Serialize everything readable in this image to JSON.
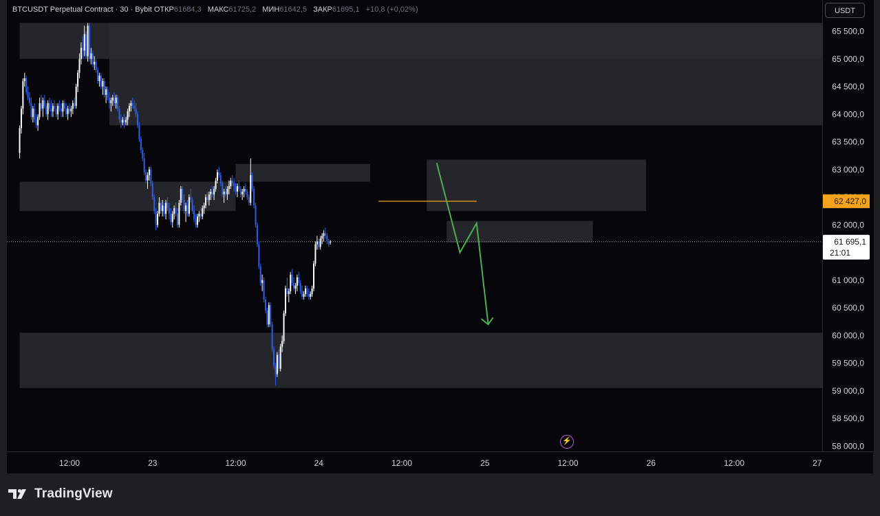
{
  "legend": {
    "symbol": "BTCUSDT Perpetual Contract · 30 · Bybit",
    "open_label": "ОТКР",
    "open_value": "61684,3",
    "high_label": "МАКС",
    "high_value": "61725,2",
    "low_label": "МИН",
    "low_value": "61642,5",
    "close_label": "ЗАКР",
    "close_value": "61695,1",
    "change": "+10,8 (+0,02%)"
  },
  "currency_button": "USDT",
  "brand": "TradingView",
  "colors": {
    "background": "#07070b",
    "frame": "#1e1f22",
    "bull": "#ffffff",
    "bear": "#2f5ee8",
    "zone": "#2a2b31",
    "orange": "#f5a31a",
    "green_arrow": "#4caf50"
  },
  "chart_data": {
    "type": "candlestick",
    "title": "",
    "xlabel": "",
    "ylabel": "",
    "ylim": [
      57800,
      66250
    ],
    "price_ticks": [
      "65 500,0",
      "65 000,0",
      "64 500,0",
      "64 000,0",
      "63 500,0",
      "63 000,0",
      "62 500,0",
      "62 000,0",
      "61 500,0",
      "61 000,0",
      "60 500,0",
      "60 000,0",
      "59 500,0",
      "59 000,0",
      "58 500,0",
      "58 000,0"
    ],
    "time_ticks": [
      {
        "label": "12:00",
        "t": 2.5
      },
      {
        "label": "23",
        "t": 7.5
      },
      {
        "label": "12:00",
        "t": 12.5
      },
      {
        "label": "24",
        "t": 17.5
      },
      {
        "label": "12:00",
        "t": 22.5
      },
      {
        "label": "25",
        "t": 27.5
      },
      {
        "label": "12:00",
        "t": 32.5
      },
      {
        "label": "26",
        "t": 37.5
      },
      {
        "label": "12:00",
        "t": 42.5
      },
      {
        "label": "27",
        "t": 47.5
      }
    ],
    "current_price": {
      "value": 61695.1,
      "label": "61 695,1",
      "countdown": "21:01"
    },
    "marked_price": {
      "value": 62427,
      "label": "62 427,0"
    },
    "zones": [
      {
        "t0": -0.5,
        "t1": 48.5,
        "low": 65000,
        "high": 65650
      },
      {
        "t0": 4.9,
        "t1": 48.5,
        "low": 63800,
        "high": 65650
      },
      {
        "t0": -0.5,
        "t1": 12.5,
        "low": 62250,
        "high": 62780
      },
      {
        "t0": 12.5,
        "t1": 20.6,
        "low": 62780,
        "high": 63100
      },
      {
        "t0": 24.0,
        "t1": 37.2,
        "low": 62250,
        "high": 63180
      },
      {
        "t0": 25.2,
        "t1": 34.0,
        "low": 61680,
        "high": 62070
      },
      {
        "t0": -0.5,
        "t1": 48.5,
        "low": 59050,
        "high": 60050
      }
    ],
    "orange_line": {
      "t0": 21.1,
      "t1": 27.0,
      "value": 62427
    },
    "green_arrow": [
      {
        "t": 24.6,
        "v": 63120
      },
      {
        "t": 26.0,
        "v": 61500
      },
      {
        "t": 27.0,
        "v": 62030
      },
      {
        "t": 27.7,
        "v": 60200
      }
    ],
    "candles": [
      [
        -0.5,
        63300,
        63800,
        63200,
        63750
      ],
      [
        -0.4,
        63750,
        64150,
        63650,
        64100
      ],
      [
        -0.3,
        64100,
        64650,
        64000,
        64600
      ],
      [
        -0.2,
        64600,
        64750,
        64500,
        64650
      ],
      [
        -0.1,
        64650,
        64700,
        64350,
        64400
      ],
      [
        0.0,
        64400,
        64500,
        64250,
        64300
      ],
      [
        0.1,
        64300,
        64400,
        64150,
        64200
      ],
      [
        0.2,
        64200,
        64300,
        63900,
        63950
      ],
      [
        0.3,
        63950,
        64150,
        63850,
        64100
      ],
      [
        0.4,
        64100,
        64200,
        63850,
        63900
      ],
      [
        0.5,
        63900,
        64000,
        63750,
        63800
      ],
      [
        0.6,
        63800,
        64000,
        63700,
        63950
      ],
      [
        0.7,
        63950,
        64300,
        63900,
        64200
      ],
      [
        0.8,
        64200,
        64350,
        64050,
        64100
      ],
      [
        0.9,
        64100,
        64300,
        63950,
        64250
      ],
      [
        1.0,
        64250,
        64350,
        64100,
        64150
      ],
      [
        1.1,
        64150,
        64200,
        63950,
        64000
      ],
      [
        1.2,
        64000,
        64250,
        63900,
        64200
      ],
      [
        1.3,
        64200,
        64300,
        64050,
        64100
      ],
      [
        1.4,
        64100,
        64250,
        63950,
        64050
      ],
      [
        1.5,
        64050,
        64200,
        63950,
        64150
      ],
      [
        1.6,
        64150,
        64250,
        64050,
        64100
      ],
      [
        1.7,
        64100,
        64200,
        63950,
        64000
      ],
      [
        1.8,
        64000,
        64200,
        63900,
        64150
      ],
      [
        1.9,
        64150,
        64250,
        64050,
        64100
      ],
      [
        2.0,
        64100,
        64200,
        63950,
        64050
      ],
      [
        2.1,
        64050,
        64250,
        63950,
        64200
      ],
      [
        2.2,
        64200,
        64250,
        64050,
        64100
      ],
      [
        2.3,
        64100,
        64200,
        63950,
        64000
      ],
      [
        2.4,
        64000,
        64150,
        63900,
        64100
      ],
      [
        2.5,
        64100,
        64200,
        64000,
        64050
      ],
      [
        2.6,
        64050,
        64150,
        63950,
        64100
      ],
      [
        2.7,
        64100,
        64250,
        64000,
        64200
      ],
      [
        2.8,
        64200,
        64300,
        64100,
        64150
      ],
      [
        2.9,
        64150,
        64550,
        64100,
        64500
      ],
      [
        3.0,
        64500,
        64800,
        64400,
        64750
      ],
      [
        3.1,
        64750,
        65100,
        64650,
        65000
      ],
      [
        3.2,
        65000,
        65300,
        64900,
        65200
      ],
      [
        3.3,
        65200,
        65400,
        65000,
        65150
      ],
      [
        3.4,
        65150,
        65600,
        65050,
        65450
      ],
      [
        3.5,
        65450,
        65500,
        65000,
        65050
      ],
      [
        3.6,
        65050,
        65650,
        64950,
        65600
      ],
      [
        3.7,
        65600,
        65650,
        64950,
        65000
      ],
      [
        3.8,
        65000,
        65200,
        64900,
        65100
      ],
      [
        3.9,
        65100,
        65150,
        64850,
        64900
      ],
      [
        4.0,
        64900,
        65050,
        64800,
        64950
      ],
      [
        4.1,
        64950,
        65000,
        64750,
        64800
      ],
      [
        4.2,
        64800,
        64850,
        64550,
        64600
      ],
      [
        4.3,
        64600,
        64750,
        64500,
        64700
      ],
      [
        4.4,
        64700,
        64750,
        64450,
        64500
      ],
      [
        4.5,
        64500,
        64650,
        64350,
        64600
      ],
      [
        4.6,
        64600,
        64650,
        64300,
        64350
      ],
      [
        4.7,
        64350,
        64500,
        64200,
        64450
      ],
      [
        4.8,
        64450,
        64500,
        64250,
        64300
      ],
      [
        4.9,
        64300,
        64400,
        64100,
        64200
      ],
      [
        5.0,
        64200,
        64300,
        64050,
        64250
      ],
      [
        5.1,
        64250,
        64350,
        64150,
        64300
      ],
      [
        5.2,
        64300,
        64400,
        64150,
        64200
      ],
      [
        5.3,
        64200,
        64350,
        64100,
        64300
      ],
      [
        5.4,
        64300,
        64350,
        64050,
        64100
      ],
      [
        5.5,
        64100,
        64150,
        63850,
        63900
      ],
      [
        5.6,
        63900,
        64000,
        63750,
        63850
      ],
      [
        5.7,
        63850,
        63950,
        63800,
        63900
      ],
      [
        5.8,
        63900,
        64000,
        63750,
        63850
      ],
      [
        5.9,
        63850,
        63950,
        63800,
        63900
      ],
      [
        6.0,
        63900,
        64100,
        63800,
        64050
      ],
      [
        6.1,
        64050,
        64200,
        63950,
        64150
      ],
      [
        6.2,
        64150,
        64250,
        64050,
        64200
      ],
      [
        6.3,
        64200,
        64300,
        64100,
        64150
      ],
      [
        6.4,
        64150,
        64250,
        64050,
        64100
      ],
      [
        6.5,
        64100,
        64200,
        63950,
        64000
      ],
      [
        6.6,
        64000,
        64050,
        63750,
        63800
      ],
      [
        6.7,
        63800,
        63850,
        63500,
        63550
      ],
      [
        6.8,
        63550,
        63600,
        63300,
        63350
      ],
      [
        6.9,
        63350,
        63400,
        63150,
        63200
      ],
      [
        7.0,
        63200,
        63300,
        62900,
        62950
      ],
      [
        7.1,
        62950,
        63000,
        62750,
        62800
      ],
      [
        7.2,
        62800,
        62950,
        62650,
        62900
      ],
      [
        7.3,
        62900,
        63050,
        62800,
        63000
      ],
      [
        7.4,
        63000,
        63050,
        62700,
        62750
      ],
      [
        7.5,
        62750,
        62800,
        62450,
        62500
      ],
      [
        7.6,
        62500,
        62550,
        62200,
        62250
      ],
      [
        7.7,
        62250,
        62300,
        61900,
        62000
      ],
      [
        7.8,
        62000,
        62250,
        61950,
        62200
      ],
      [
        7.9,
        62200,
        62500,
        62150,
        62400
      ],
      [
        8.0,
        62400,
        62450,
        62200,
        62250
      ],
      [
        8.1,
        62250,
        62450,
        62150,
        62350
      ],
      [
        8.2,
        62350,
        62400,
        62150,
        62200
      ],
      [
        8.3,
        62200,
        62450,
        62100,
        62400
      ],
      [
        8.4,
        62400,
        62500,
        62250,
        62300
      ],
      [
        8.5,
        62300,
        62400,
        62100,
        62200
      ],
      [
        8.6,
        62200,
        62300,
        62000,
        62050
      ],
      [
        8.7,
        62050,
        62250,
        61950,
        62200
      ],
      [
        8.8,
        62200,
        62350,
        62100,
        62300
      ],
      [
        8.9,
        62300,
        62400,
        62150,
        62200
      ],
      [
        9.0,
        62200,
        62300,
        61950,
        62000
      ],
      [
        9.1,
        62000,
        62450,
        61950,
        62400
      ],
      [
        9.2,
        62400,
        62700,
        62350,
        62650
      ],
      [
        9.3,
        62650,
        62700,
        62400,
        62450
      ],
      [
        9.4,
        62450,
        62550,
        62200,
        62250
      ],
      [
        9.5,
        62250,
        62400,
        62050,
        62350
      ],
      [
        9.6,
        62350,
        62450,
        62150,
        62200
      ],
      [
        9.7,
        62200,
        62550,
        62150,
        62500
      ],
      [
        9.8,
        62500,
        62650,
        62400,
        62450
      ],
      [
        9.9,
        62450,
        62500,
        62200,
        62250
      ],
      [
        10.0,
        62250,
        62350,
        62050,
        62100
      ],
      [
        10.1,
        62100,
        62200,
        61950,
        62000
      ],
      [
        10.2,
        62000,
        62200,
        61950,
        62150
      ],
      [
        10.3,
        62150,
        62250,
        62050,
        62200
      ],
      [
        10.4,
        62200,
        62300,
        62100,
        62150
      ],
      [
        10.5,
        62150,
        62350,
        62100,
        62300
      ],
      [
        10.6,
        62300,
        62400,
        62200,
        62350
      ],
      [
        10.7,
        62350,
        62550,
        62300,
        62500
      ],
      [
        10.8,
        62500,
        62600,
        62400,
        62450
      ],
      [
        10.9,
        62450,
        62600,
        62350,
        62550
      ],
      [
        11.0,
        62550,
        62650,
        62450,
        62600
      ],
      [
        11.1,
        62600,
        62700,
        62500,
        62550
      ],
      [
        11.2,
        62550,
        62700,
        62450,
        62650
      ],
      [
        11.3,
        62650,
        62850,
        62600,
        62800
      ],
      [
        11.4,
        62800,
        63000,
        62750,
        62950
      ],
      [
        11.5,
        62950,
        63050,
        62850,
        62900
      ],
      [
        11.6,
        62900,
        62950,
        62700,
        62750
      ],
      [
        11.7,
        62750,
        62800,
        62500,
        62550
      ],
      [
        11.8,
        62550,
        62650,
        62400,
        62600
      ],
      [
        11.9,
        62600,
        62700,
        62500,
        62550
      ],
      [
        12.0,
        62550,
        62700,
        62450,
        62650
      ],
      [
        12.1,
        62650,
        62800,
        62550,
        62700
      ],
      [
        12.2,
        62700,
        62850,
        62650,
        62800
      ],
      [
        12.3,
        62800,
        62900,
        62700,
        62750
      ],
      [
        12.4,
        62750,
        62850,
        62600,
        62700
      ],
      [
        12.5,
        62700,
        62750,
        62550,
        62600
      ],
      [
        12.6,
        62600,
        62750,
        62500,
        62700
      ],
      [
        12.7,
        62700,
        62800,
        62600,
        62650
      ],
      [
        12.8,
        62650,
        62700,
        62500,
        62550
      ],
      [
        12.9,
        62550,
        62650,
        62450,
        62600
      ],
      [
        13.0,
        62600,
        62700,
        62500,
        62650
      ],
      [
        13.1,
        62650,
        62750,
        62550,
        62600
      ],
      [
        13.2,
        62600,
        62650,
        62450,
        62500
      ],
      [
        13.3,
        62500,
        62550,
        62350,
        62400
      ],
      [
        13.4,
        62400,
        63200,
        62350,
        62900
      ],
      [
        13.5,
        62900,
        62950,
        62600,
        62650
      ],
      [
        13.6,
        62650,
        62700,
        62300,
        62350
      ],
      [
        13.7,
        62350,
        62400,
        61950,
        62000
      ],
      [
        13.8,
        62000,
        62050,
        61600,
        61650
      ],
      [
        13.9,
        61650,
        61700,
        61200,
        61250
      ],
      [
        14.0,
        61250,
        61300,
        60900,
        60950
      ],
      [
        14.1,
        60950,
        61100,
        60800,
        61000
      ],
      [
        14.2,
        61000,
        61050,
        60600,
        60650
      ],
      [
        14.3,
        60650,
        60700,
        60400,
        60450
      ],
      [
        14.4,
        60450,
        60500,
        60150,
        60200
      ],
      [
        14.5,
        60200,
        60600,
        60150,
        60550
      ],
      [
        14.6,
        60550,
        60600,
        60150,
        60200
      ],
      [
        14.7,
        60200,
        60250,
        59700,
        59750
      ],
      [
        14.8,
        59750,
        59800,
        59400,
        59450
      ],
      [
        14.9,
        59450,
        59500,
        59100,
        59300
      ],
      [
        15.0,
        59300,
        59700,
        59250,
        59650
      ],
      [
        15.1,
        59650,
        59750,
        59350,
        59400
      ],
      [
        15.2,
        59400,
        59850,
        59350,
        59800
      ],
      [
        15.3,
        59800,
        60000,
        59700,
        59900
      ],
      [
        15.4,
        59900,
        60450,
        59850,
        60400
      ],
      [
        15.5,
        60400,
        60900,
        60350,
        60850
      ],
      [
        15.6,
        60850,
        61050,
        60700,
        60750
      ],
      [
        15.7,
        60750,
        60850,
        60600,
        60800
      ],
      [
        15.8,
        60800,
        61150,
        60750,
        61100
      ],
      [
        15.9,
        61100,
        61200,
        60900,
        60950
      ],
      [
        16.0,
        60950,
        61050,
        60800,
        60850
      ],
      [
        16.1,
        60850,
        60950,
        60750,
        60900
      ],
      [
        16.2,
        60900,
        61100,
        60800,
        61050
      ],
      [
        16.3,
        61050,
        61150,
        60900,
        60950
      ],
      [
        16.4,
        60950,
        61000,
        60750,
        60800
      ],
      [
        16.5,
        60800,
        60900,
        60650,
        60700
      ],
      [
        16.6,
        60700,
        60800,
        60650,
        60750
      ],
      [
        16.7,
        60750,
        60900,
        60700,
        60850
      ],
      [
        16.8,
        60850,
        60900,
        60700,
        60750
      ],
      [
        16.9,
        60750,
        60850,
        60650,
        60700
      ],
      [
        17.0,
        60700,
        60800,
        60650,
        60750
      ],
      [
        17.1,
        60750,
        60900,
        60700,
        60850
      ],
      [
        17.2,
        60850,
        61350,
        60800,
        61300
      ],
      [
        17.3,
        61300,
        61700,
        61250,
        61650
      ],
      [
        17.4,
        61650,
        61800,
        61550,
        61700
      ],
      [
        17.5,
        61700,
        61750,
        61550,
        61600
      ],
      [
        17.6,
        61600,
        61800,
        61550,
        61750
      ],
      [
        17.7,
        61750,
        61850,
        61650,
        61800
      ],
      [
        17.8,
        61800,
        61900,
        61700,
        61850
      ],
      [
        17.9,
        61850,
        61950,
        61750,
        61800
      ],
      [
        18.0,
        61800,
        61850,
        61650,
        61700
      ],
      [
        18.1,
        61700,
        61750,
        61600,
        61650
      ],
      [
        18.2,
        61684,
        61725,
        61642,
        61695
      ]
    ]
  }
}
